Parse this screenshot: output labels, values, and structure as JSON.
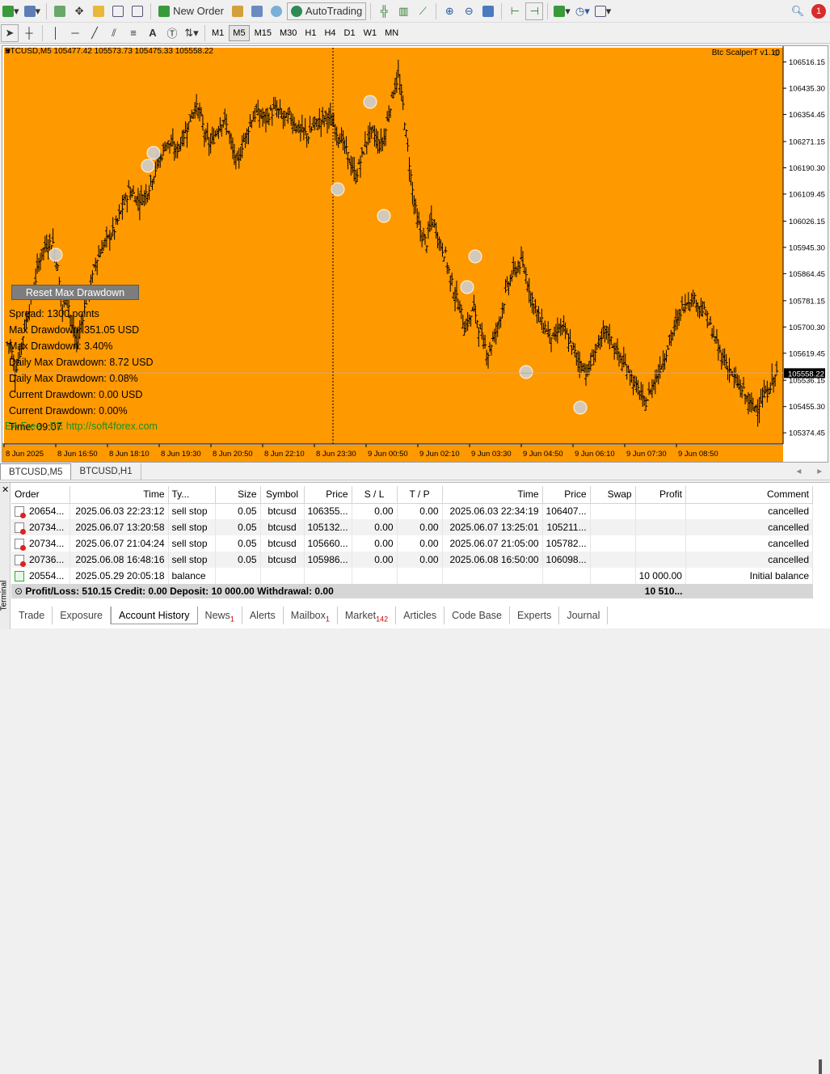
{
  "toolbar": {
    "new_order_label": "New Order",
    "autotrading_label": "AutoTrading",
    "notification_count": "1",
    "timeframes": [
      "M1",
      "M5",
      "M15",
      "M30",
      "H1",
      "H4",
      "D1",
      "W1",
      "MN"
    ],
    "active_timeframe": "M5"
  },
  "chart": {
    "symbol_info": "BTCUSD,M5  105477.42 105573.73 105475.33 105558.22",
    "ea_name": "Btc ScalperT v1.10",
    "background_color": "#ff9900",
    "current_price_label": "105558.22",
    "reset_button_label": "Reset Max Drawdown",
    "watermark": "EA Free . EE  http://soft4forex.com",
    "info_lines": [
      "Spread: 1300 points",
      "Max Drawdown: 351.05 USD",
      "Max Drawdown: 3.40%",
      "Daily Max Drawdown: 8.72 USD",
      "Daily Max Drawdown: 0.08%",
      "Current Drawdown: 0.00 USD",
      "Current Drawdown: 0.00%",
      "Time: 09:07"
    ]
  },
  "chart_data": {
    "type": "ohlc-bar",
    "symbol": "BTCUSD",
    "timeframe": "M5",
    "y_ticks": [
      106516.15,
      106435.3,
      106354.45,
      106271.15,
      106190.3,
      106109.45,
      106026.15,
      105945.3,
      105864.45,
      105781.15,
      105700.3,
      105619.45,
      105536.15,
      105455.3,
      105374.45
    ],
    "x_ticks": [
      "8 Jun 2025",
      "8 Jun 16:50",
      "8 Jun 18:10",
      "8 Jun 19:30",
      "8 Jun 20:50",
      "8 Jun 22:10",
      "8 Jun 23:30",
      "9 Jun 00:50",
      "9 Jun 02:10",
      "9 Jun 03:30",
      "9 Jun 04:50",
      "9 Jun 06:10",
      "9 Jun 07:30",
      "9 Jun 08:50"
    ],
    "ylim": [
      105340,
      106560
    ],
    "close_path": [
      105650,
      105560,
      105620,
      105700,
      105760,
      105820,
      105900,
      105940,
      105960,
      105960,
      105880,
      105750,
      105800,
      105700,
      105650,
      105710,
      105780,
      105830,
      105900,
      105930,
      105960,
      105980,
      106000,
      106040,
      106080,
      106120,
      106110,
      106090,
      106100,
      106120,
      106160,
      106200,
      106230,
      106270,
      106260,
      106240,
      106270,
      106300,
      106340,
      106380,
      106360,
      106300,
      106260,
      106280,
      106320,
      106340,
      106310,
      106240,
      106200,
      106260,
      106300,
      106340,
      106360,
      106350,
      106340,
      106360,
      106370,
      106360,
      106340,
      106350,
      106330,
      106310,
      106300,
      106290,
      106320,
      106330,
      106340,
      106350,
      106330,
      106300,
      106280,
      106240,
      106200,
      106160,
      106210,
      106260,
      106300,
      106290,
      106260,
      106280,
      106360,
      106430,
      106470,
      106380,
      106250,
      106120,
      106030,
      105980,
      105960,
      106030,
      106000,
      105950,
      105920,
      105850,
      105800,
      105760,
      105700,
      105720,
      105760,
      105700,
      105650,
      105620,
      105660,
      105700,
      105760,
      105820,
      105860,
      105880,
      105900,
      105860,
      105800,
      105760,
      105720,
      105700,
      105680,
      105660,
      105700,
      105690,
      105660,
      105630,
      105600,
      105580,
      105560,
      105600,
      105640,
      105660,
      105690,
      105660,
      105630,
      105600,
      105580,
      105560,
      105520,
      105500,
      105460,
      105490,
      105530,
      105560,
      105600,
      105640,
      105680,
      105720,
      105760,
      105780,
      105790,
      105780,
      105760,
      105740,
      105700,
      105660,
      105620,
      105600,
      105570,
      105540,
      105520,
      105500,
      105470,
      105450,
      105460,
      105480,
      105500,
      105530,
      105560
    ]
  },
  "chart_tabs": [
    "BTCUSD,M5",
    "BTCUSD,H1"
  ],
  "terminal": {
    "side_label": "Terminal",
    "columns": [
      "Order",
      "Time",
      "Ty...",
      "Size",
      "Symbol",
      "Price",
      "S / L",
      "T / P",
      "Time",
      "Price",
      "Swap",
      "Profit",
      "Comment"
    ],
    "rows": [
      {
        "order": "20654...",
        "time": "2025.06.03 22:23:12",
        "type": "sell stop",
        "size": "0.05",
        "symbol": "btcusd",
        "price": "106355...",
        "sl": "0.00",
        "tp": "0.00",
        "close_time": "2025.06.03 22:34:19",
        "close_price": "106407...",
        "swap": "",
        "profit": "",
        "comment": "cancelled",
        "icon": "red"
      },
      {
        "order": "20734...",
        "time": "2025.06.07 13:20:58",
        "type": "sell stop",
        "size": "0.05",
        "symbol": "btcusd",
        "price": "105132...",
        "sl": "0.00",
        "tp": "0.00",
        "close_time": "2025.06.07 13:25:01",
        "close_price": "105211...",
        "swap": "",
        "profit": "",
        "comment": "cancelled",
        "icon": "red"
      },
      {
        "order": "20734...",
        "time": "2025.06.07 21:04:24",
        "type": "sell stop",
        "size": "0.05",
        "symbol": "btcusd",
        "price": "105660...",
        "sl": "0.00",
        "tp": "0.00",
        "close_time": "2025.06.07 21:05:00",
        "close_price": "105782...",
        "swap": "",
        "profit": "",
        "comment": "cancelled",
        "icon": "red"
      },
      {
        "order": "20736...",
        "time": "2025.06.08 16:48:16",
        "type": "sell stop",
        "size": "0.05",
        "symbol": "btcusd",
        "price": "105986...",
        "sl": "0.00",
        "tp": "0.00",
        "close_time": "2025.06.08 16:50:00",
        "close_price": "106098...",
        "swap": "",
        "profit": "",
        "comment": "cancelled",
        "icon": "red"
      },
      {
        "order": "20554...",
        "time": "2025.05.29 20:05:18",
        "type": "balance",
        "size": "",
        "symbol": "",
        "price": "",
        "sl": "",
        "tp": "",
        "close_time": "",
        "close_price": "",
        "swap": "",
        "profit": "10 000.00",
        "comment": "Initial balance",
        "icon": "green"
      }
    ],
    "summary_text": "Profit/Loss: 510.15  Credit: 0.00  Deposit: 10 000.00  Withdrawal: 0.00",
    "summary_profit": "10 510...",
    "bottom_tabs": [
      {
        "label": "Trade",
        "badge": ""
      },
      {
        "label": "Exposure",
        "badge": ""
      },
      {
        "label": "Account History",
        "badge": ""
      },
      {
        "label": "News",
        "badge": "1"
      },
      {
        "label": "Alerts",
        "badge": ""
      },
      {
        "label": "Mailbox",
        "badge": "1"
      },
      {
        "label": "Market",
        "badge": "142"
      },
      {
        "label": "Articles",
        "badge": ""
      },
      {
        "label": "Code Base",
        "badge": ""
      },
      {
        "label": "Experts",
        "badge": ""
      },
      {
        "label": "Journal",
        "badge": ""
      }
    ],
    "active_tab": "Account History"
  }
}
